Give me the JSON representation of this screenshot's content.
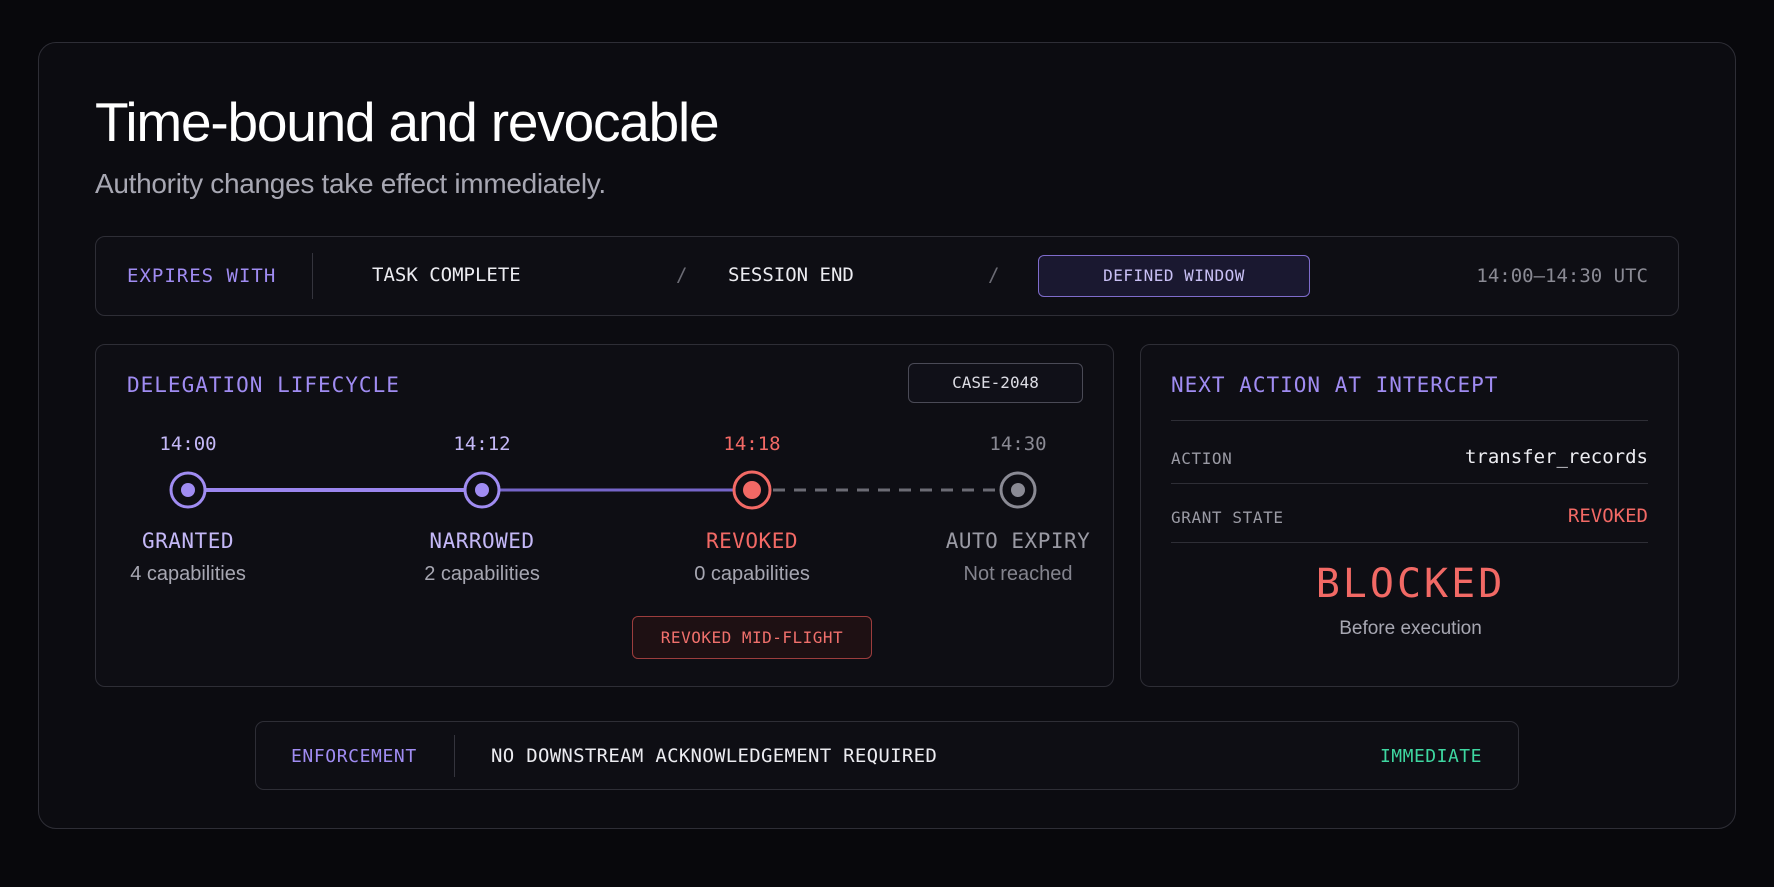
{
  "colors": {
    "accent": "#a08cf2",
    "revoked": "#f26965",
    "inactive": "#8a8a94",
    "immediate": "#3ed6a0",
    "background": "#08080c"
  },
  "header": {
    "title": "Time-bound and revocable",
    "subtitle": "Authority changes take effect immediately."
  },
  "expiry": {
    "label": "EXPIRES WITH",
    "options": [
      "TASK COMPLETE",
      "SESSION END",
      "DEFINED WINDOW"
    ],
    "separator": "/",
    "selected": "DEFINED WINDOW",
    "window": "14:00–14:30 UTC"
  },
  "lifecycle": {
    "title": "DELEGATION LIFECYCLE",
    "case_id": "CASE-2048",
    "stages": [
      {
        "time": "14:00",
        "name": "GRANTED",
        "capabilities": "4 capabilities",
        "state": "active"
      },
      {
        "time": "14:12",
        "name": "NARROWED",
        "capabilities": "2 capabilities",
        "state": "active"
      },
      {
        "time": "14:18",
        "name": "REVOKED",
        "capabilities": "0 capabilities",
        "state": "revoked"
      },
      {
        "time": "14:30",
        "name": "AUTO EXPIRY",
        "capabilities": "Not reached",
        "state": "inactive"
      }
    ],
    "flag": "REVOKED MID-FLIGHT"
  },
  "intercept": {
    "title": "NEXT ACTION AT INTERCEPT",
    "action_label": "ACTION",
    "action_value": "transfer_records",
    "grant_label": "GRANT STATE",
    "grant_value": "REVOKED",
    "result": "BLOCKED",
    "result_note": "Before execution"
  },
  "enforcement": {
    "label": "ENFORCEMENT",
    "message": "NO DOWNSTREAM ACKNOWLEDGEMENT REQUIRED",
    "status": "IMMEDIATE"
  }
}
